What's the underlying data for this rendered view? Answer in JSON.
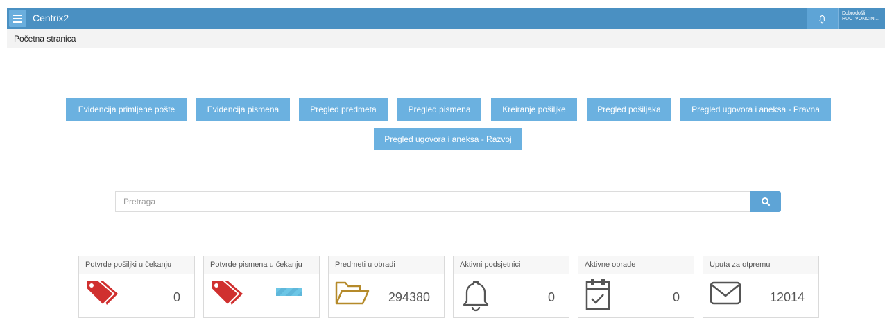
{
  "header": {
    "app_title": "Centrix2",
    "menu_icon": "hamburger-menu-icon",
    "bell_icon": "bell-icon",
    "user_line1": "Dobrodošli,",
    "user_line2": "HUC_VONCINI..."
  },
  "breadcrumb": "Početna stranica",
  "quick_buttons": [
    "Evidencija primljene pošte",
    "Evidencija pismena",
    "Pregled predmeta",
    "Pregled pismena",
    "Kreiranje pošiljke",
    "Pregled pošiljaka",
    "Pregled ugovora i aneksa - Pravna",
    "Pregled ugovora i aneksa - Razvoj"
  ],
  "search": {
    "placeholder": "Pretraga",
    "value": "",
    "icon": "search-icon"
  },
  "cards": [
    {
      "title": "Potvrde pošiljki u čekanju",
      "value": "0",
      "icon": "tags-icon",
      "icon_color": "#d0302f"
    },
    {
      "title": "Potvrde pismena u čekanju",
      "value": "",
      "icon": "tags-icon",
      "icon_color": "#d0302f"
    },
    {
      "title": "Predmeti u obradi",
      "value": "294380",
      "icon": "folder-open-icon",
      "icon_color": "#b58a2a"
    },
    {
      "title": "Aktivni podsjetnici",
      "value": "0",
      "icon": "bell-icon",
      "icon_color": "#555555"
    },
    {
      "title": "Aktivne obrade",
      "value": "0",
      "icon": "calendar-check-icon",
      "icon_color": "#555555"
    },
    {
      "title": "Uputa za otpremu",
      "value": "12014",
      "icon": "envelope-icon",
      "icon_color": "#555555"
    }
  ],
  "colors": {
    "header_bg": "#4a90c2",
    "button_bg": "#6bb1e0",
    "search_button_bg": "#5ea4d6"
  }
}
